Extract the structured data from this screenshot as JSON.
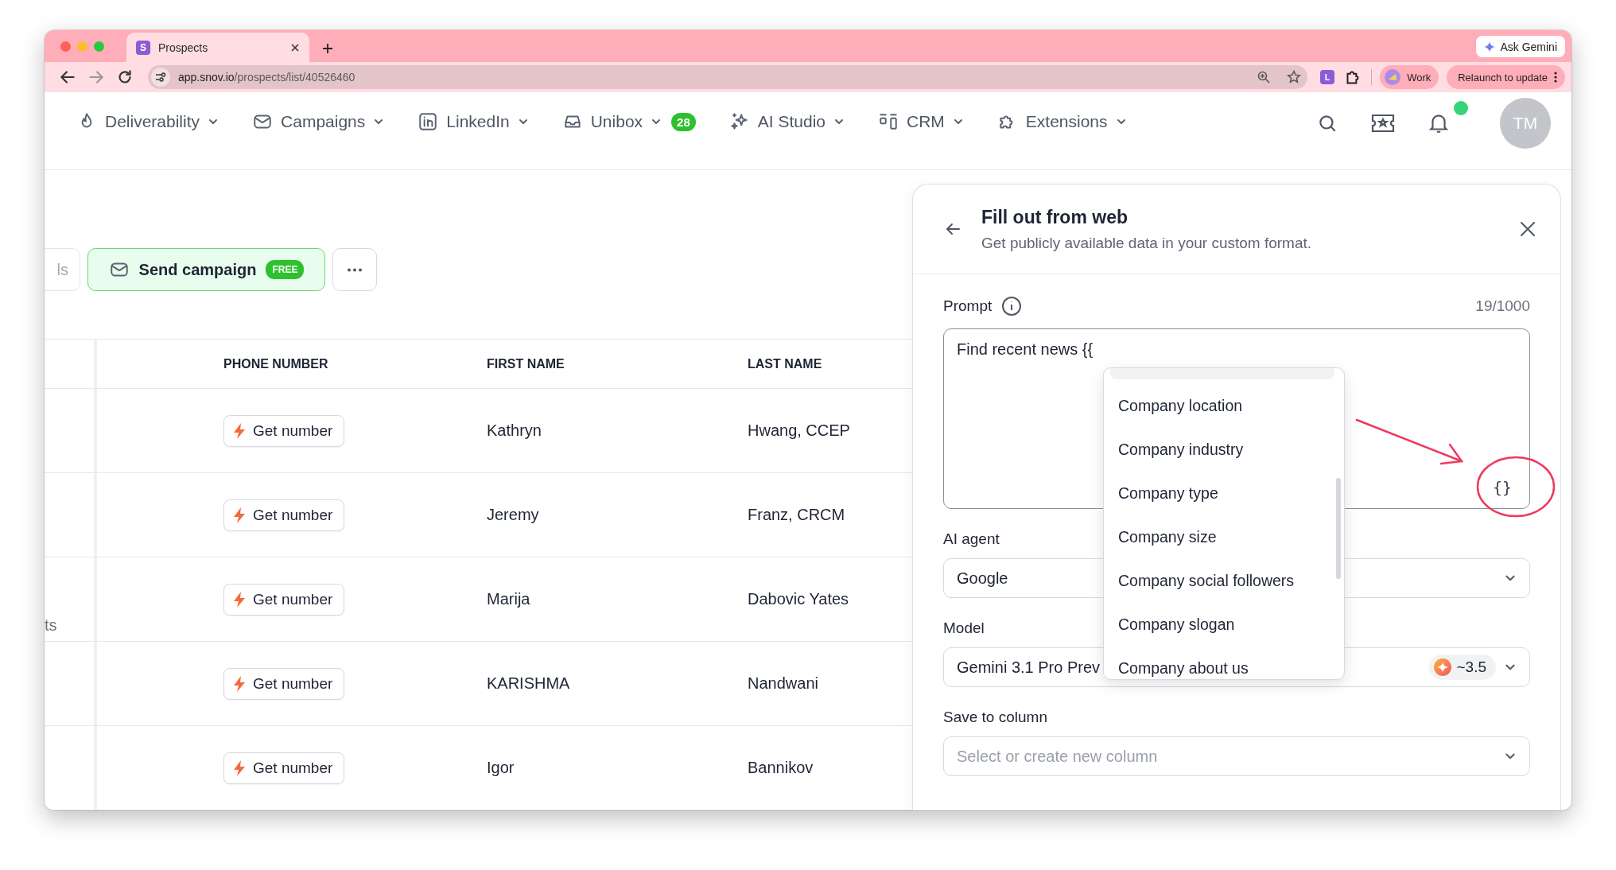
{
  "browser": {
    "tabs": [
      {
        "title": "Prospects",
        "favicon": "S",
        "selected": true
      }
    ],
    "ask_gemini": "Ask Gemini",
    "url_domain": "app.snov.io",
    "url_path": "/prospects/list/40526460",
    "extension_letter": "L",
    "profile": "Work",
    "relaunch": "Relaunch to update"
  },
  "nav": {
    "items": [
      {
        "label": "Deliverability"
      },
      {
        "label": "Campaigns"
      },
      {
        "label": "LinkedIn"
      },
      {
        "label": "Unibox",
        "badge": "28"
      },
      {
        "label": "AI Studio"
      },
      {
        "label": "CRM"
      },
      {
        "label": "Extensions"
      }
    ],
    "notification_dot": true,
    "avatar": "TM"
  },
  "toolbar": {
    "cut_button": "ls",
    "send_campaign": "Send campaign",
    "free_badge": "FREE"
  },
  "table": {
    "columns": [
      "PHONE NUMBER",
      "FIRST NAME",
      "LAST NAME"
    ],
    "rows": [
      {
        "phone_action": "Get number",
        "first_name": "Kathryn",
        "last_name": "Hwang, CCEP"
      },
      {
        "phone_action": "Get number",
        "first_name": "Jeremy",
        "last_name": "Franz, CRCM"
      },
      {
        "phone_action": "Get number",
        "first_name": "Marija",
        "last_name": "Dabovic Yates",
        "side_label": "ts"
      },
      {
        "phone_action": "Get number",
        "first_name": "KARISHMA",
        "last_name": "Nandwani"
      },
      {
        "phone_action": "Get number",
        "first_name": "Igor",
        "last_name": "Bannikov"
      }
    ]
  },
  "panel": {
    "title": "Fill out from web",
    "subtitle": "Get publicly available data in your custom format.",
    "prompt_label": "Prompt",
    "counter": "19/1000",
    "prompt_value": "Find recent news {{",
    "variable_button": "{}",
    "suggestions": [
      "Company location",
      "Company industry",
      "Company type",
      "Company size",
      "Company social followers",
      "Company slogan",
      "Company about us"
    ],
    "fields": [
      {
        "label": "AI agent",
        "value": "Google"
      },
      {
        "label": "Model",
        "value": "Gemini 3.1 Pro Prev",
        "credits": "~3.5"
      },
      {
        "label": "Save to column",
        "placeholder": "Select or create new column"
      }
    ]
  }
}
